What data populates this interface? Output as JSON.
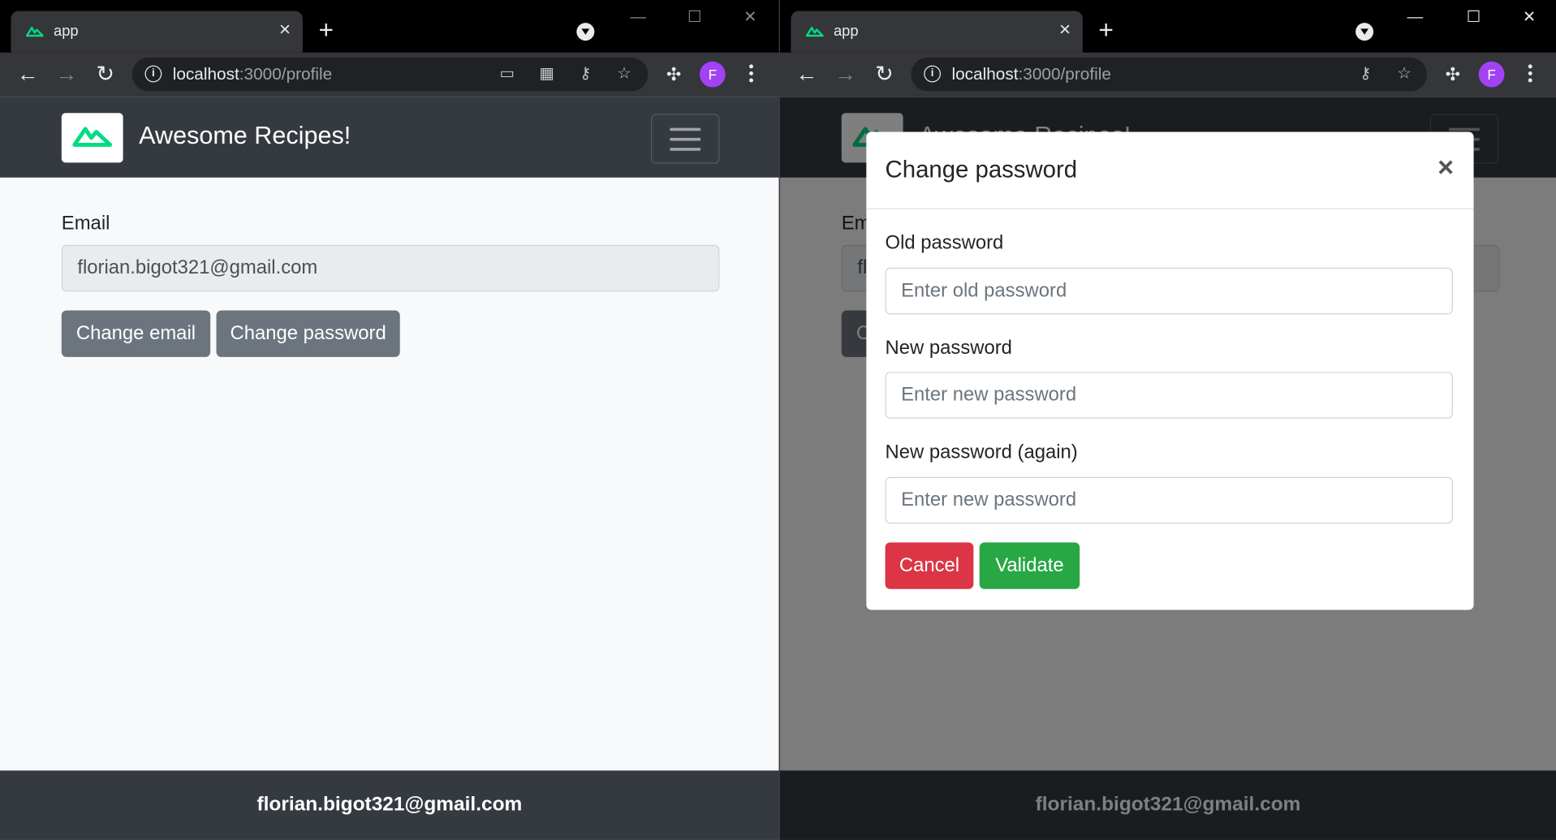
{
  "browser": {
    "tab_title": "app",
    "tab_close": "×",
    "new_tab": "+",
    "url_host": "localhost",
    "url_path": ":3000/profile",
    "info_icon": "i",
    "profile_initial": "F"
  },
  "app": {
    "brand_name": "Awesome Recipes!",
    "brand_color": "#00dc82",
    "navbar_color": "#343a40"
  },
  "profile": {
    "email_label": "Email",
    "email_value": "florian.bigot321@gmail.com",
    "change_email_label": "Change email",
    "change_password_label": "Change password"
  },
  "footer": {
    "user_email": "florian.bigot321@gmail.com"
  },
  "modal": {
    "title": "Change password",
    "close_label": "×",
    "old_password_label": "Old password",
    "old_password_placeholder": "Enter old password",
    "new_password_label": "New password",
    "new_password_placeholder": "Enter new password",
    "new_password_again_label": "New password (again)",
    "new_password_again_placeholder": "Enter new password",
    "cancel_label": "Cancel",
    "validate_label": "Validate",
    "cancel_color": "#dc3545",
    "validate_color": "#28a745"
  },
  "icons": {
    "back": "back-arrow-icon",
    "forward": "forward-arrow-icon",
    "reload": "reload-icon",
    "cast": "cast-icon",
    "qr": "qr-code-icon",
    "key": "key-icon",
    "star": "star-icon",
    "extensions": "puzzle-icon",
    "menu": "kebab-menu-icon"
  }
}
